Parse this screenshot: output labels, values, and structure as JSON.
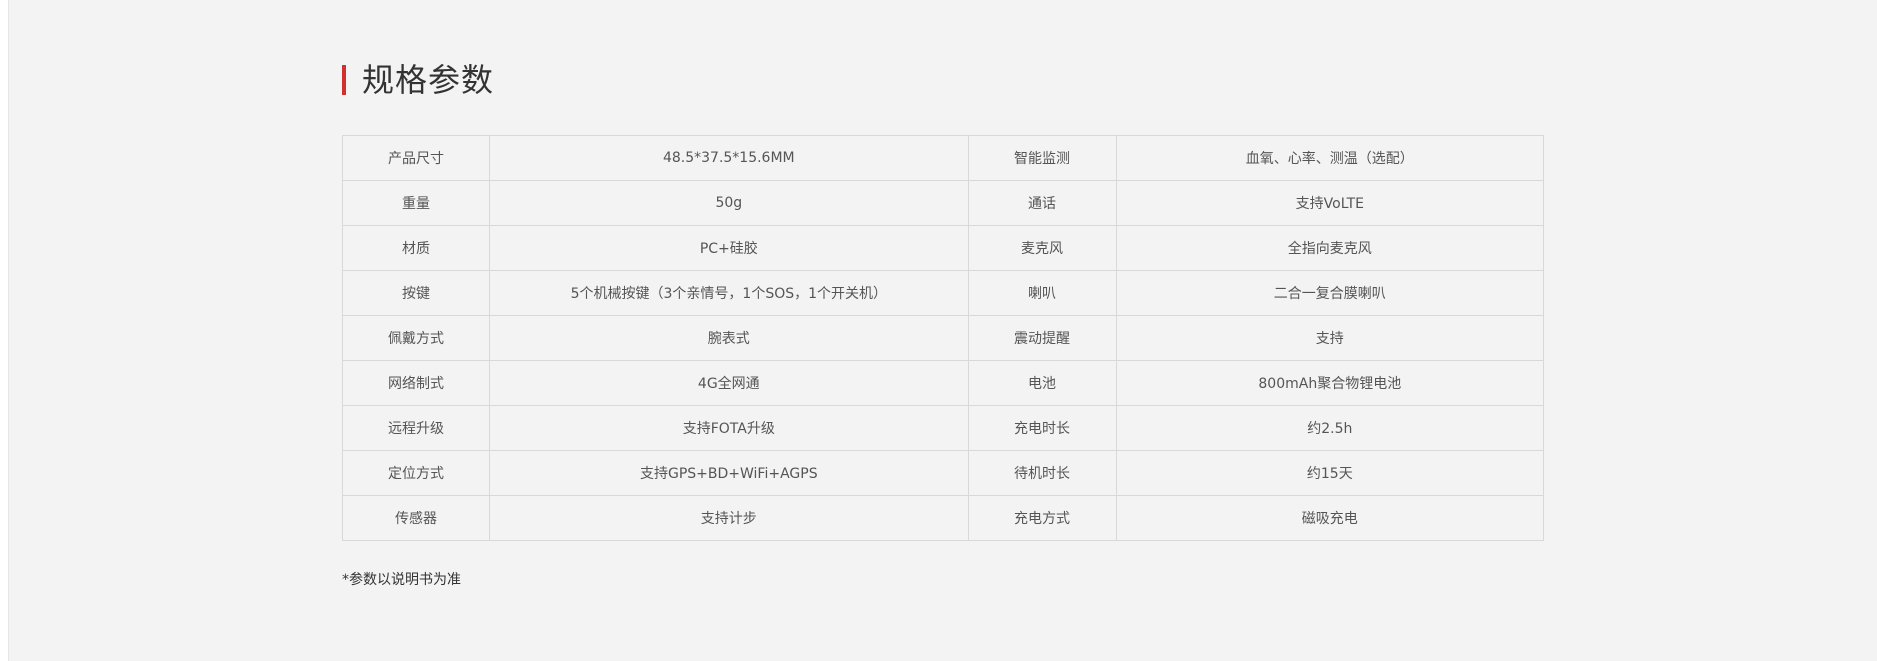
{
  "section": {
    "title": "规格参数",
    "accent_color": "#d22f2f",
    "footnote": "*参数以说明书为准"
  },
  "specs": [
    {
      "label1": "产品尺寸",
      "value1": "48.5*37.5*15.6MM",
      "label2": "智能监测",
      "value2": "血氧、心率、测温（选配）"
    },
    {
      "label1": "重量",
      "value1": "50g",
      "label2": "通话",
      "value2": "支持VoLTE"
    },
    {
      "label1": "材质",
      "value1": "PC+硅胶",
      "label2": "麦克风",
      "value2": "全指向麦克风"
    },
    {
      "label1": "按键",
      "value1": "5个机械按键（3个亲情号，1个SOS，1个开关机）",
      "label2": "喇叭",
      "value2": "二合一复合膜喇叭"
    },
    {
      "label1": "佩戴方式",
      "value1": "腕表式",
      "label2": "震动提醒",
      "value2": "支持"
    },
    {
      "label1": "网络制式",
      "value1": "4G全网通",
      "label2": "电池",
      "value2": "800mAh聚合物锂电池"
    },
    {
      "label1": "远程升级",
      "value1": "支持FOTA升级",
      "label2": "充电时长",
      "value2": "约2.5h"
    },
    {
      "label1": "定位方式",
      "value1": "支持GPS+BD+WiFi+AGPS",
      "label2": "待机时长",
      "value2": "约15天"
    },
    {
      "label1": "传感器",
      "value1": "支持计步",
      "label2": "充电方式",
      "value2": "磁吸充电"
    }
  ]
}
